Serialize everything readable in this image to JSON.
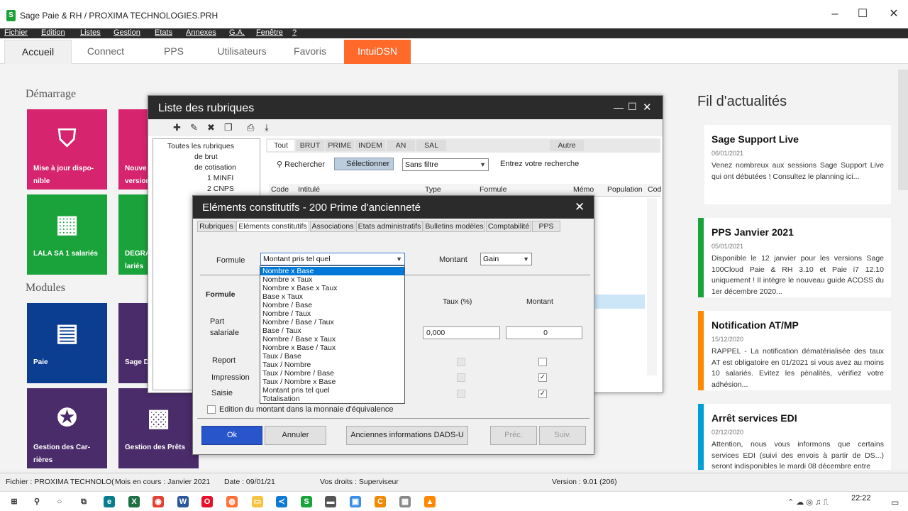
{
  "window": {
    "title": "Sage Paie & RH / PROXIMA TECHNOLOGIES.PRH"
  },
  "menu": [
    "Fichier",
    "Edition",
    "Listes",
    "Gestion",
    "Etats",
    "Annexes",
    "G.A.",
    "Fenêtre",
    "?"
  ],
  "tabs": [
    "Accueil",
    "Connect",
    "PPS",
    "Utilisateurs",
    "Favoris",
    "IntuiDSN"
  ],
  "home": {
    "demarrage": "Démarrage",
    "modules": "Modules",
    "tiles": {
      "t1": "Mise à jour dispo-nible",
      "t2": "Nouve version",
      "t3": "LALA SA 1 salariés",
      "t4": "DEGRA lariés",
      "t5": "Paie",
      "t6": "Sage D",
      "t7": "Gestion des Car-rières",
      "t8": "Gestion des Prêts"
    }
  },
  "news": {
    "title": "Fil d'actualités",
    "items": [
      {
        "title": "Sage Support Live",
        "date": "06/01/2021",
        "body": "Venez nombreux aux sessions Sage Support Live qui ont débutées ! Consultez le planning ici..."
      },
      {
        "title": "PPS Janvier 2021",
        "date": "05/01/2021",
        "body": "Disponible le 12 janvier pour les versions Sage 100Cloud Paie & RH 3.10 et Paie i7 12.10 uniquement ! Il intègre le nouveau guide ACOSS du 1er décembre 2020..."
      },
      {
        "title": "Notification AT/MP",
        "date": "15/12/2020",
        "body": "RAPPEL - La notification dématérialisée des taux AT est obligatoire en 01/2021 si vous avez au moins 10 salariés. Evitez les pénalités, vérifiez votre adhésion..."
      },
      {
        "title": "Arrêt services EDI",
        "date": "02/12/2020",
        "body": "Attention, nous vous informons que certains services EDI (suivi des envois à partir de DS...) seront indisponibles le mardi 08 décembre entre"
      }
    ],
    "colors": [
      "#ff8a00",
      "#1aa33a",
      "#ff8a00",
      "#00a0d6"
    ]
  },
  "list": {
    "title": "Liste des rubriques",
    "tree": [
      "Toutes les rubriques",
      "de brut",
      "de cotisation",
      "1 MINFI",
      "2 CNPS"
    ],
    "categories": [
      "Tout",
      "BRUT",
      "PRIME",
      "INDEM",
      "AN",
      "SAL",
      "Autre"
    ],
    "search": "Rechercher",
    "select": "Sélectionner",
    "filter": "Sans filtre",
    "entry": "Entrez votre recherche",
    "columns": [
      "Code",
      "Intitulé",
      "Type",
      "Formule",
      "Mémo",
      "Population",
      "Cod"
    ]
  },
  "modal": {
    "title": "Eléments constitutifs - 200 Prime d'ancienneté",
    "tabs": [
      "Rubriques",
      "Eléments constitutifs",
      "Associations",
      "Etats administratifs",
      "Bulletins modèles",
      "Comptabilité",
      "PPS"
    ],
    "formule_label": "Formule",
    "formule_value": "Montant pris tel quel",
    "montant_label": "Montant",
    "montant_value": "Gain",
    "section": "Formule",
    "col_taux": "Taux (%)",
    "col_montant": "Montant",
    "part": "Part salariale",
    "taux_value": "0,000",
    "montant_value2": "0",
    "report": "Report",
    "impression": "Impression",
    "saisie": "Saisie",
    "edition": "Edition du montant dans la monnaie d'équivalence",
    "btn_ok": "Ok",
    "btn_annuler": "Annuler",
    "btn_dads": "Anciennes informations DADS-U",
    "btn_prec": "Préc.",
    "btn_suiv": "Suiv.",
    "options": [
      "Nombre x Base",
      "Nombre x Taux",
      "Nombre x Base x Taux",
      "Base x Taux",
      "Nombre / Base",
      "Nombre / Taux",
      "Nombre / Base / Taux",
      "Base / Taux",
      "Nombre / Base x Taux",
      "Nombre x Base / Taux",
      "Taux / Base",
      "Taux / Nombre",
      "Taux / Nombre / Base",
      "Taux / Nombre x Base",
      "Montant pris tel quel",
      "Totalisation"
    ]
  },
  "status": {
    "fichier": "Fichier : PROXIMA TECHNOLO(",
    "mois": "Mois en cours : Janvier 2021",
    "date": "Date : 09/01/21",
    "droits": "Vos droits : Superviseur",
    "version": "Version : 9.01 (206)"
  },
  "taskbar": {
    "time": "22:22",
    "date": "09/01/2021"
  }
}
